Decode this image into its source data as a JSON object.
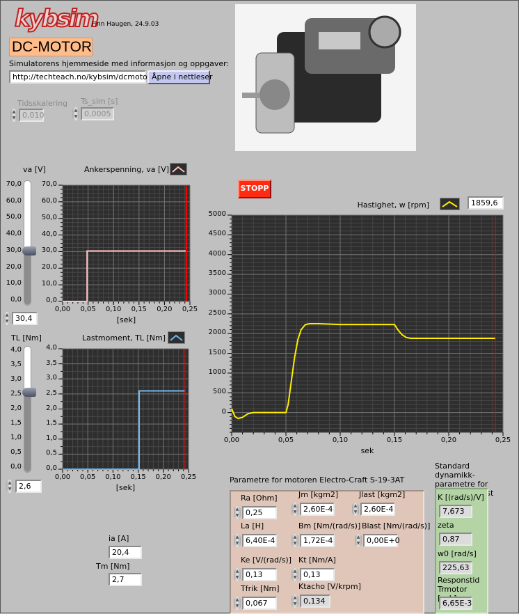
{
  "header": {
    "logo": "kybsim",
    "author": "Finn Haugen, 24.9.03",
    "title": "DC-MOTOR",
    "homepage_label": "Simulatorens hjemmeside med informasjon og oppgaver:",
    "url": "http://techteach.no/kybsim/dcmotor/",
    "open_button": "Åpne i nettleser"
  },
  "settings": {
    "time_scaling_label": "Tidsskalering",
    "time_scaling": "0,010",
    "ts_sim_label": "Ts_sim [s]",
    "ts_sim": "0,0005"
  },
  "controls": {
    "va_label": "va [V]",
    "va_value": "30,4",
    "va_level": 30.4,
    "va_max": 70,
    "tl_label": "TL [Nm]",
    "tl_value": "2,6",
    "tl_level": 2.6,
    "tl_max": 4,
    "va_slider_ticks": [
      "70,0",
      "60,0",
      "50,0",
      "40,0",
      "30,0",
      "20,0",
      "10,0",
      "0,0"
    ],
    "tl_slider_ticks": [
      "4,0",
      "3,5",
      "3,0",
      "2,5",
      "2,0",
      "1,5",
      "1,0",
      "0,5",
      "0,0"
    ],
    "stop_button": "STOPP"
  },
  "speed": {
    "label": "Hastighet, w [rpm]",
    "value": "1859,6"
  },
  "outputs": {
    "ia_label": "ia [A]",
    "ia": "20,4",
    "tm_label": "Tm [Nm]",
    "tm": "2,7"
  },
  "params": {
    "title": "Parametre for motoren Electro-Craft S-19-3AT",
    "fields": [
      {
        "label": "Ra [Ohm]",
        "value": "0,25"
      },
      {
        "label": "Jm [kgm2]",
        "value": "2,60E-4"
      },
      {
        "label": "Jlast [kgm2]",
        "value": "2,60E-4"
      },
      {
        "label": "La [H]",
        "value": "6,40E-4"
      },
      {
        "label": "Bm [Nm/(rad/s)]",
        "value": "1,72E-4"
      },
      {
        "label": "Blast [Nm/(rad/s)]",
        "value": "0,00E+0"
      },
      {
        "label": "Ke [V/(rad/s)]",
        "value": "0,13"
      },
      {
        "label": "Kt [Nm/A]",
        "value": "0,13"
      },
      {
        "label": "Tfrik [Nm]",
        "value": "0,067"
      },
      {
        "label": "Ktacho [V/krpm]",
        "value": "0,134"
      }
    ]
  },
  "dynamics": {
    "title": "Standard dynamikk-parametre for motor med last",
    "fields": [
      {
        "label": "K [(rad/s)/V]",
        "value": "7,673"
      },
      {
        "label": "zeta",
        "value": "0,87"
      },
      {
        "label": "w0 [rad/s]",
        "value": "225,63"
      },
      {
        "label": "Responstid Trmotor [sek]",
        "value": "6,65E-3"
      }
    ]
  },
  "colors": {
    "va_series": "#ffc0c0",
    "tl_series": "#70b8f0",
    "speed_series": "#ffee00",
    "cursor": "#ff0000",
    "plot_bg": "#2e2e2e",
    "stop": "#ff2a10"
  },
  "chart_data": [
    {
      "type": "line",
      "title": "Ankerspenning, va [V]",
      "xlabel": "[sek]",
      "xlim": [
        0,
        0.25
      ],
      "ylim": [
        0,
        70
      ],
      "grid": true,
      "x_ticks": [
        0,
        0.05,
        0.1,
        0.15,
        0.2,
        0.25
      ],
      "x_tick_labels": [
        "0,00",
        "0,05",
        "0,10",
        "0,15",
        "0,20",
        "0,25"
      ],
      "y_ticks": [
        0,
        10,
        20,
        30,
        40,
        50,
        60,
        70
      ],
      "y_tick_labels": [
        "0,0",
        "10,0",
        "20,0",
        "30,0",
        "40,0",
        "50,0",
        "60,0",
        "70,0"
      ],
      "cursor": 0.243,
      "series": [
        {
          "color": "#ffc0c0",
          "points": [
            [
              0,
              0
            ],
            [
              0.048,
              0
            ],
            [
              0.048,
              30.4
            ],
            [
              0.243,
              30.4
            ]
          ]
        }
      ]
    },
    {
      "type": "line",
      "title": "Lastmoment, TL [Nm]",
      "xlabel": "[sek]",
      "xlim": [
        0,
        0.25
      ],
      "ylim": [
        0,
        4
      ],
      "grid": true,
      "x_ticks": [
        0,
        0.05,
        0.1,
        0.15,
        0.2,
        0.25
      ],
      "x_tick_labels": [
        "0,00",
        "0,05",
        "0,10",
        "0,15",
        "0,20",
        "0,25"
      ],
      "y_ticks": [
        0,
        0.5,
        1,
        1.5,
        2,
        2.5,
        3,
        3.5,
        4
      ],
      "y_tick_labels": [
        "0,0",
        "0,5",
        "1,0",
        "1,5",
        "2,0",
        "2,5",
        "3,0",
        "3,5",
        "4,0"
      ],
      "cursor": 0.243,
      "series": [
        {
          "color": "#70b8f0",
          "points": [
            [
              0,
              0
            ],
            [
              0.152,
              0
            ],
            [
              0.152,
              2.6
            ],
            [
              0.243,
              2.6
            ]
          ]
        }
      ]
    },
    {
      "type": "line",
      "title": "Hastighet, w [rpm]",
      "xlabel": "sek",
      "xlim": [
        0,
        0.25
      ],
      "ylim": [
        -500,
        5000
      ],
      "grid": true,
      "x_ticks": [
        0,
        0.05,
        0.1,
        0.15,
        0.2,
        0.25
      ],
      "x_tick_labels": [
        "0,00",
        "0,05",
        "0,10",
        "0,15",
        "0,20",
        "0,25"
      ],
      "y_ticks": [
        0,
        500,
        1000,
        1500,
        2000,
        2500,
        3000,
        3500,
        4000,
        4500,
        5000
      ],
      "y_tick_labels": [
        "0",
        "500",
        "1000",
        "1500",
        "2000",
        "2500",
        "3000",
        "3500",
        "4000",
        "4500",
        "5000"
      ],
      "cursor": 0.243,
      "series": [
        {
          "color": "#ffee00",
          "points": [
            [
              0,
              100
            ],
            [
              0.003,
              -100
            ],
            [
              0.006,
              -150
            ],
            [
              0.01,
              -120
            ],
            [
              0.015,
              -30
            ],
            [
              0.02,
              0
            ],
            [
              0.05,
              0
            ],
            [
              0.052,
              200
            ],
            [
              0.055,
              800
            ],
            [
              0.058,
              1400
            ],
            [
              0.061,
              1850
            ],
            [
              0.064,
              2100
            ],
            [
              0.068,
              2230
            ],
            [
              0.072,
              2250
            ],
            [
              0.08,
              2250
            ],
            [
              0.1,
              2230
            ],
            [
              0.15,
              2230
            ],
            [
              0.153,
              2100
            ],
            [
              0.157,
              1970
            ],
            [
              0.161,
              1900
            ],
            [
              0.165,
              1880
            ],
            [
              0.243,
              1880
            ]
          ]
        }
      ]
    }
  ]
}
